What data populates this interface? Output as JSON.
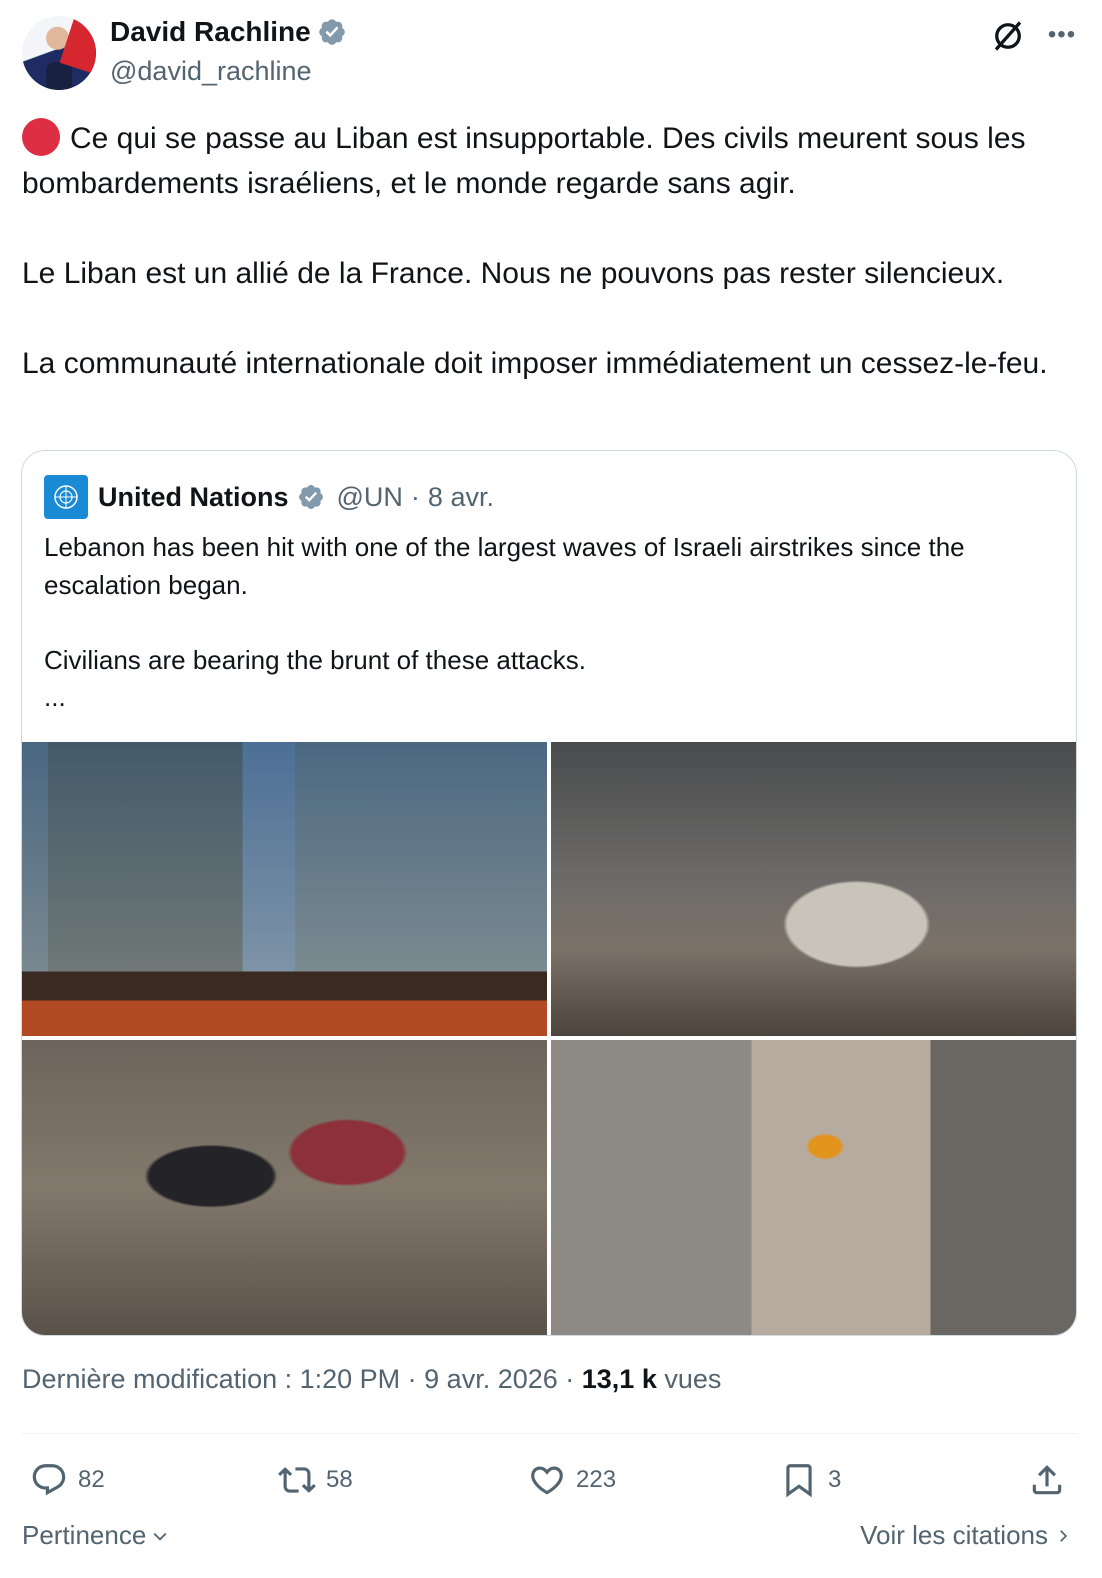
{
  "author": {
    "name": "David Rachline",
    "handle": "@david_rachline"
  },
  "tweet": {
    "paragraphs": [
      "Ce qui se passe au Liban est insupportable. Des civils meurent sous les bombardements israéliens, et le monde regarde sans agir.",
      "Le Liban est un allié de la France. Nous ne pouvons pas rester silencieux.",
      "La communauté internationale doit imposer immédiatement un cessez-le-feu."
    ]
  },
  "quote": {
    "name": "United Nations",
    "handle": "@UN",
    "separator": "·",
    "date": "8 avr.",
    "paragraphs": [
      "Lebanon has been hit with one of the largest waves of Israeli airstrikes since the escalation began.",
      "Civilians are bearing the brunt of these attacks."
    ],
    "ellipsis": "..."
  },
  "meta": {
    "prefix": "Dernière modification : 1:20 PM · 9 avr. 2026 · ",
    "views_count": "13,1 k",
    "views_label": "vues"
  },
  "actions": {
    "replies": "82",
    "retweets": "58",
    "likes": "223",
    "bookmarks": "3"
  },
  "footer": {
    "sort_label": "Pertinence",
    "quotes_link": "Voir les citations"
  },
  "colors": {
    "verified": "#829aab",
    "text": "#0f1419",
    "secondary": "#536471",
    "border": "#cfd9de",
    "red_circle": "#dd2e44",
    "un_blue": "#1b8ad4"
  }
}
